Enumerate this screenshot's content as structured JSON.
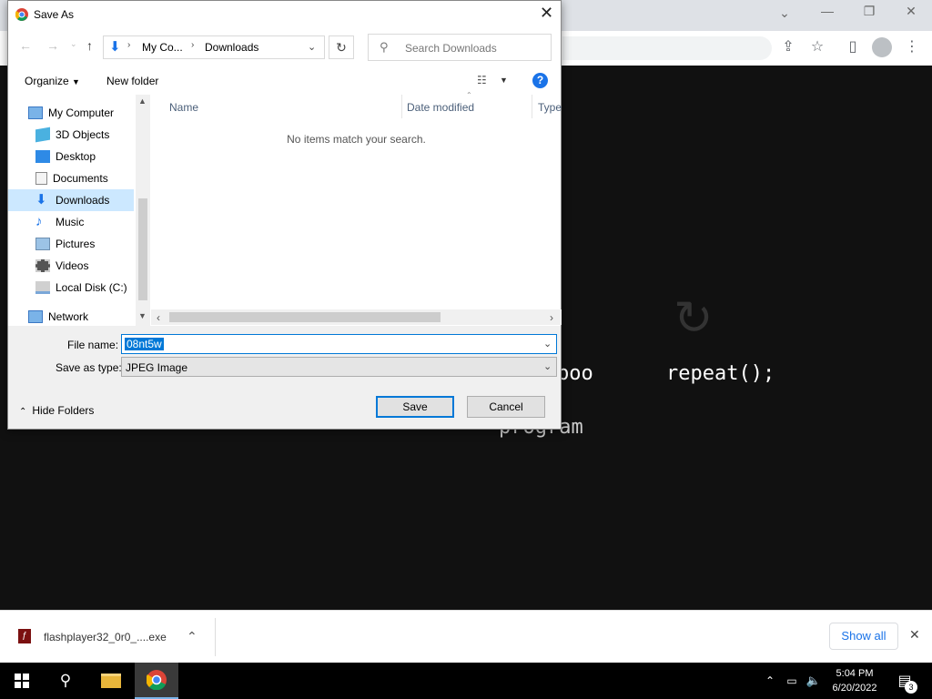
{
  "dialog": {
    "title": "Save As",
    "breadcrumb": {
      "part1": "My Co...",
      "part2": "Downloads"
    },
    "search_placeholder": "Search Downloads",
    "organize_label": "Organize",
    "new_folder_label": "New folder",
    "nav_items": [
      {
        "label": "My Computer",
        "icon": "computer-icon"
      },
      {
        "label": "3D Objects",
        "icon": "cube-icon"
      },
      {
        "label": "Desktop",
        "icon": "desktop-icon"
      },
      {
        "label": "Documents",
        "icon": "documents-icon"
      },
      {
        "label": "Downloads",
        "icon": "download-folder-icon",
        "selected": true
      },
      {
        "label": "Music",
        "icon": "music-icon"
      },
      {
        "label": "Pictures",
        "icon": "pictures-icon"
      },
      {
        "label": "Videos",
        "icon": "videos-icon"
      },
      {
        "label": "Local Disk (C:)",
        "icon": "disk-icon"
      },
      {
        "label": "Network",
        "icon": "network-icon"
      }
    ],
    "columns": {
      "name": "Name",
      "date_modified": "Date modified",
      "type": "Type"
    },
    "empty_message": "No items match your search.",
    "file_name_label": "File name:",
    "file_name_value": "08nt5w",
    "save_type_label": "Save as type:",
    "save_type_value": "JPEG Image",
    "hide_folders_label": "Hide Folders",
    "save_label": "Save",
    "cancel_label": "Cancel"
  },
  "background": {
    "text_left": "boo",
    "text_right": "repeat();",
    "text_bottom": "program"
  },
  "downloads_bar": {
    "filename": "flashplayer32_0r0_....exe",
    "show_all_label": "Show all"
  },
  "taskbar": {
    "time": "5:04 PM",
    "date": "6/20/2022",
    "notification_count": "3"
  },
  "colors": {
    "accent": "#0078d7",
    "selection": "#cce8ff",
    "dark_bg": "#111111"
  }
}
